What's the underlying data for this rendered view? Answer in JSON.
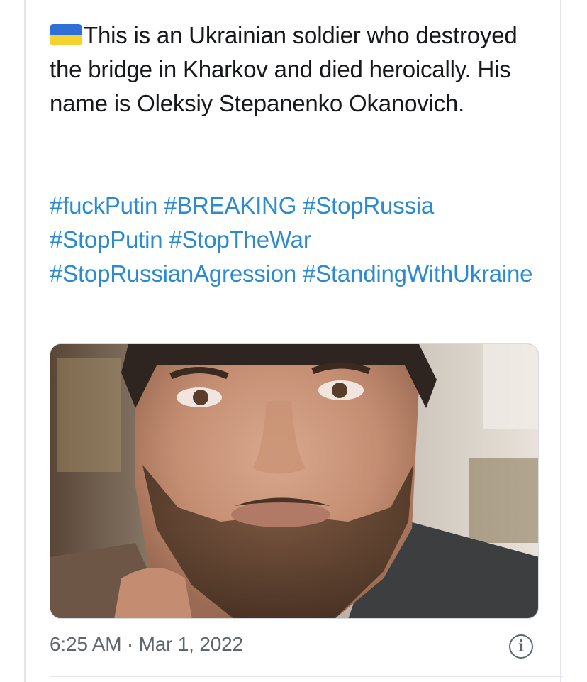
{
  "tweet": {
    "text": "This is an Ukrainian soldier who destroyed the bridge in Kharkov and died heroically. His name is Oleksiy Stepanenko Okanovich.",
    "flag_icon": "ukraine-flag-emoji",
    "hashtags": [
      "#fuckPutin",
      "#BREAKING",
      "#StopRussia",
      "#StopPutin",
      "#StopTheWar",
      "#StopRussianAgression",
      "#StandingWithUkraine"
    ],
    "timestamp": "6:25 AM · Mar 1, 2022",
    "info_icon": "info-icon"
  },
  "colors": {
    "text": "#17181a",
    "hashtag": "#2b8bd0",
    "meta": "#5f666d",
    "border": "#e3e6ea"
  }
}
